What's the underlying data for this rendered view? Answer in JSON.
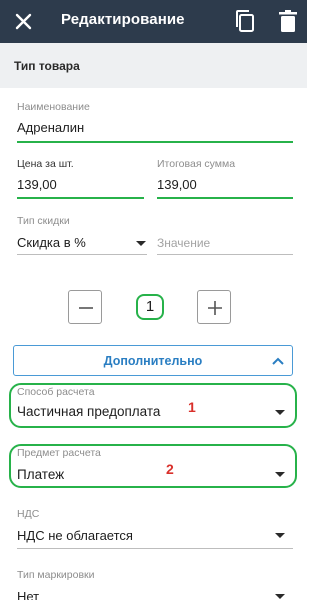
{
  "app_bar": {
    "title": "Редактирование",
    "close_icon": "close-icon",
    "copy_icon": "copy-icon",
    "delete_icon": "trash-icon"
  },
  "product_type": {
    "label": "Тип товара"
  },
  "name": {
    "label": "Наименование",
    "value": "Адреналин"
  },
  "price": {
    "label": "Цена за шт.",
    "value": "139,00"
  },
  "total": {
    "label": "Итоговая сумма",
    "value": "139,00"
  },
  "discount": {
    "label": "Тип скидки",
    "value": "Скидка в %",
    "amount_placeholder": "Значение"
  },
  "quantity": {
    "value": "1"
  },
  "more_button": {
    "label": "Дополнительно"
  },
  "payment_method": {
    "label": "Способ расчета",
    "value": "Частичная предоплата",
    "annotation": "1"
  },
  "payment_subject": {
    "label": "Предмет расчета",
    "value": "Платеж",
    "annotation": "2"
  },
  "vat": {
    "label": "НДС",
    "value": "НДС не облагается"
  },
  "marking": {
    "label": "Тип маркировки",
    "value": "Нет"
  },
  "colors": {
    "appbar": "#2d3b4c",
    "accent_green": "#27b24a",
    "link_blue": "#2a7ec2",
    "annotation_red": "#d9302b"
  }
}
